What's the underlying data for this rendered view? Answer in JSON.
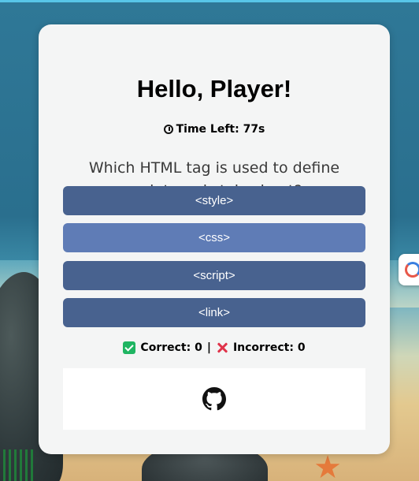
{
  "quiz": {
    "greeting": "Hello, Player!",
    "timer_text": "Time Left: 77s",
    "question": "Which HTML tag is used to define an internal style sheet?",
    "options": [
      {
        "label": "<style>"
      },
      {
        "label": "<css>"
      },
      {
        "label": "<script>"
      },
      {
        "label": "<link>"
      }
    ],
    "score": {
      "correct_text": "Correct: 0",
      "separator": "|",
      "incorrect_text": "Incorrect: 0"
    }
  },
  "icons": {
    "timer": "stopwatch-icon",
    "correct": "check-mark-icon",
    "incorrect": "cross-mark-icon",
    "footer": "github-icon"
  },
  "colors": {
    "option_button": "#48628f",
    "option_button_hover": "#5f7cb6",
    "card_background": "#f4f5f5",
    "correct_green": "#1fb562",
    "incorrect_red": "#e0334a"
  }
}
